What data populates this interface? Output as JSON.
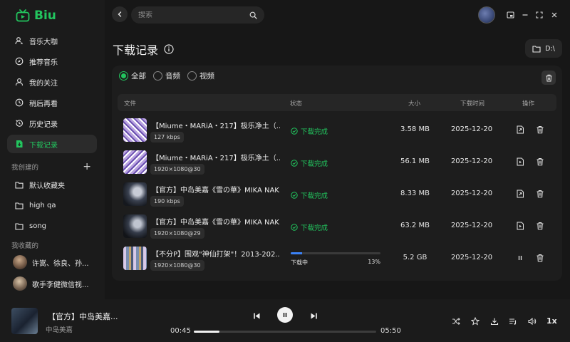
{
  "app": {
    "name": "Biu",
    "brand_color": "#22c55e"
  },
  "sidebar": {
    "nav": [
      {
        "label": "音乐大咖",
        "icon": "user-star-icon"
      },
      {
        "label": "推荐音乐",
        "icon": "compass-icon"
      },
      {
        "label": "我的关注",
        "icon": "user-icon"
      },
      {
        "label": "稍后再看",
        "icon": "clock-icon"
      },
      {
        "label": "历史记录",
        "icon": "history-icon"
      },
      {
        "label": "下载记录",
        "icon": "download-file-icon",
        "active": true
      }
    ],
    "created_title": "我创建的",
    "created": [
      {
        "label": "默认收藏夹"
      },
      {
        "label": "high qa"
      },
      {
        "label": "song"
      }
    ],
    "favorites_title": "我收藏的",
    "favorites": [
      {
        "label": "许嵩、徐良、孙..."
      },
      {
        "label": "歌手李健微信视..."
      }
    ]
  },
  "search": {
    "placeholder": "搜索"
  },
  "page": {
    "title": "下载记录",
    "dir_label": "D:\\"
  },
  "filters": [
    {
      "label": "全部",
      "selected": true
    },
    {
      "label": "音频",
      "selected": false
    },
    {
      "label": "视频",
      "selected": false
    }
  ],
  "table": {
    "headers": {
      "file": "文件",
      "status": "状态",
      "size": "大小",
      "time": "下载时间",
      "ops": "操作"
    },
    "rows": [
      {
        "title": "【Miume・MARiA・217】极乐净土（...",
        "badge": "127 kbps",
        "status": "下载完成",
        "size": "3.58 MB",
        "date": "2025-12-20",
        "thumb": "purple"
      },
      {
        "title": "【Miume・MARiA・217】极乐净土（...",
        "badge": "1920×1080@30",
        "status": "下载完成",
        "size": "56.1 MB",
        "date": "2025-12-20",
        "thumb": "purple"
      },
      {
        "title": "【官方】中岛美嘉《雪の華》MIKA NAK...",
        "badge": "190 kbps",
        "status": "下载完成",
        "size": "8.33 MB",
        "date": "2025-12-20",
        "thumb": "dark"
      },
      {
        "title": "【官方】中岛美嘉《雪の華》MIKA NAK...",
        "badge": "1920×1080@29",
        "status": "下载完成",
        "size": "63.2 MB",
        "date": "2025-12-20",
        "thumb": "dark"
      },
      {
        "title": "【不分P】围观\"神仙打架\"！2013-202...",
        "badge": "1920×1080@30",
        "status": "下载中",
        "progress_text": "13%",
        "progress": 13,
        "size": "5.2 GB",
        "date": "2025-12-20",
        "thumb": "collage"
      }
    ]
  },
  "player": {
    "title": "【官方】中岛美嘉...",
    "artist": "中岛美嘉",
    "current": "00:45",
    "total": "05:50",
    "progress": 14,
    "speed": "1x"
  }
}
